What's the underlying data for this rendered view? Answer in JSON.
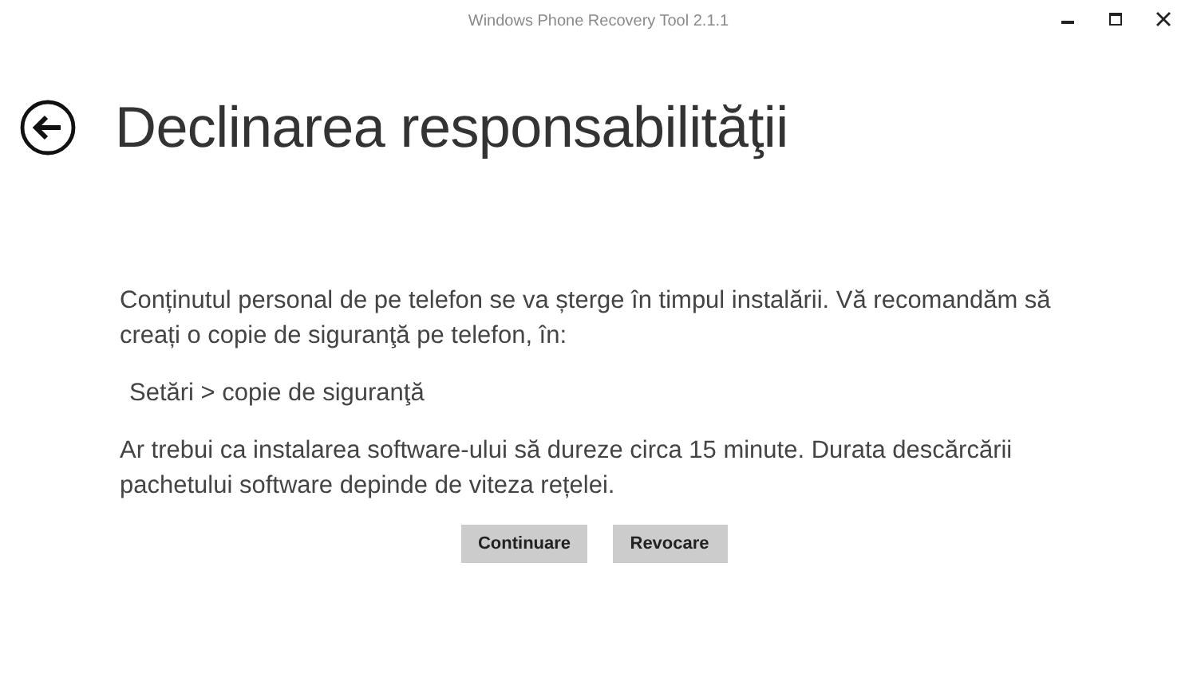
{
  "window": {
    "title": "Windows Phone Recovery Tool 2.1.1"
  },
  "page": {
    "title": "Declinarea responsabilităţii"
  },
  "paragraphs": [
    {
      "kind": "text",
      "text": "Conținutul personal de pe telefon se va șterge în timpul instalării. Vă recomandăm să creați o copie de siguranţă pe telefon, în:"
    },
    {
      "kind": "path",
      "text": "Setări > copie de siguranţă"
    },
    {
      "kind": "text",
      "text": "Ar trebui ca instalarea software-ului să dureze circa 15 minute. Durata descărcării pachetului software depinde de viteza rețelei."
    }
  ],
  "buttons": [
    "Continuare",
    "Revocare"
  ]
}
